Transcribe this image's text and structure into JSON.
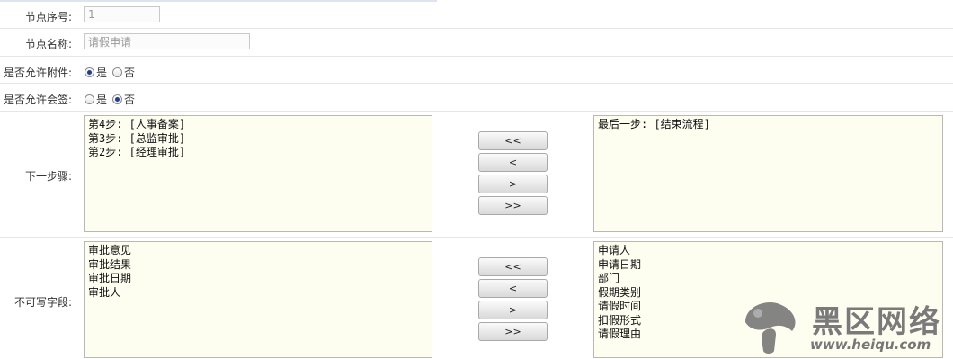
{
  "form": {
    "node_index": {
      "label": "节点序号:",
      "value": "1"
    },
    "node_name": {
      "label": "节点名称:",
      "value": "请假申请"
    },
    "allow_attachment": {
      "label": "是否允许附件:",
      "options": [
        "是",
        "否"
      ],
      "selected": "是"
    },
    "allow_countersign": {
      "label": "是否允许会签:",
      "options": [
        "是",
        "否"
      ],
      "selected": "否"
    },
    "next_steps": {
      "label": "下一步骤:",
      "available": [
        "第4步: [人事备案]",
        "第3步: [总监审批]",
        "第2步: [经理审批]"
      ],
      "selected": [
        "最后一步: [结束流程]"
      ],
      "buttons": [
        "<<",
        "<",
        ">",
        ">>"
      ]
    },
    "readonly_fields": {
      "label": "不可写字段:",
      "available": [
        "审批意见",
        "审批结果",
        "审批日期",
        "审批人"
      ],
      "selected": [
        "申请人",
        "申请日期",
        "部门",
        "假期类别",
        "请假时间",
        "扣假形式",
        "请假理由"
      ],
      "buttons": [
        "<<",
        "<",
        ">",
        ">>"
      ]
    }
  },
  "watermark": {
    "text": "黑区网络",
    "url": "www.heiqu.com"
  }
}
